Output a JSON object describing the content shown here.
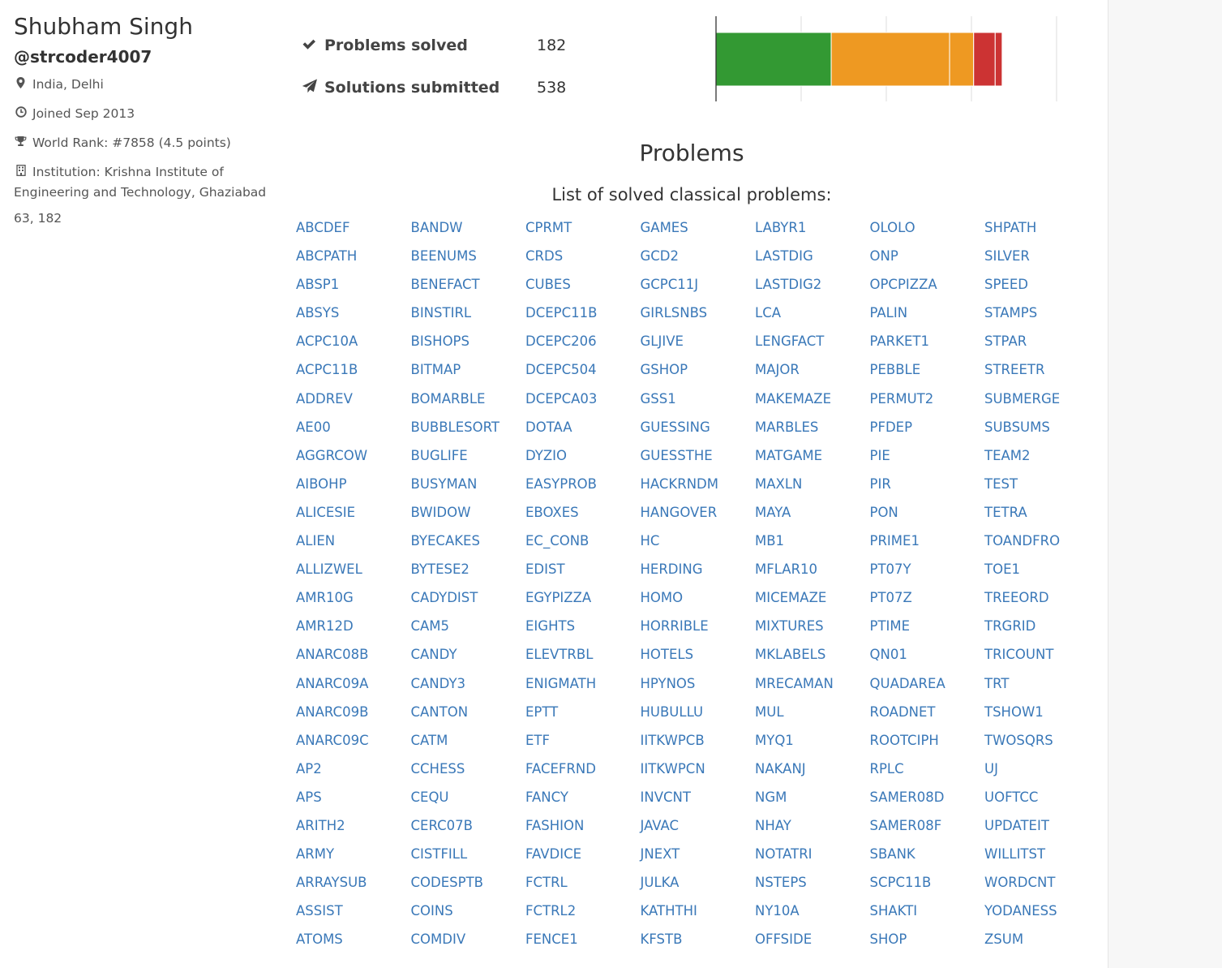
{
  "profile": {
    "name": "Shubham Singh",
    "handle": "@strcoder4007",
    "location": "India, Delhi",
    "joined": "Joined Sep 2013",
    "rank": "World Rank: #7858 (4.5 points)",
    "institution": "Institution: Krishna Institute of Engineering and Technology, Ghaziabad",
    "counts": "63, 182",
    "icons": [
      "map-marker-icon",
      "clock-icon",
      "trophy-icon",
      "building-icon"
    ]
  },
  "stats": {
    "solved_label": "Problems solved",
    "solved_value": "182",
    "submitted_label": "Solutions submitted",
    "submitted_value": "538"
  },
  "chart_data": {
    "type": "bar",
    "orientation": "horizontal-stacked",
    "total": 538,
    "series": [
      {
        "value": 182,
        "color": "#339933"
      },
      {
        "value": 187,
        "color": "#ee9922"
      },
      {
        "value": 38,
        "color": "#ee9922"
      },
      {
        "value": 34,
        "color": "#cc3333"
      },
      {
        "value": 11,
        "color": "#cc3333"
      }
    ],
    "grid": true
  },
  "problems": {
    "title": "Problems",
    "subtitle": "List of solved classical problems:",
    "link_color": "#3a78b8",
    "columns": [
      [
        "ABCDEF",
        "ABCPATH",
        "ABSP1",
        "ABSYS",
        "ACPC10A",
        "ACPC11B",
        "ADDREV",
        "AE00",
        "AGGRCOW",
        "AIBOHP",
        "ALICESIE",
        "ALIEN",
        "ALLIZWEL",
        "AMR10G",
        "AMR12D",
        "ANARC08B",
        "ANARC09A",
        "ANARC09B",
        "ANARC09C",
        "AP2",
        "APS",
        "ARITH2",
        "ARMY",
        "ARRAYSUB",
        "ASSIST",
        "ATOMS"
      ],
      [
        "BANDW",
        "BEENUMS",
        "BENEFACT",
        "BINSTIRL",
        "BISHOPS",
        "BITMAP",
        "BOMARBLE",
        "BUBBLESORT",
        "BUGLIFE",
        "BUSYMAN",
        "BWIDOW",
        "BYECAKES",
        "BYTESE2",
        "CADYDIST",
        "CAM5",
        "CANDY",
        "CANDY3",
        "CANTON",
        "CATM",
        "CCHESS",
        "CEQU",
        "CERC07B",
        "CISTFILL",
        "CODESPTB",
        "COINS",
        "COMDIV"
      ],
      [
        "CPRMT",
        "CRDS",
        "CUBES",
        "DCEPC11B",
        "DCEPC206",
        "DCEPC504",
        "DCEPCA03",
        "DOTAA",
        "DYZIO",
        "EASYPROB",
        "EBOXES",
        "EC_CONB",
        "EDIST",
        "EGYPIZZA",
        "EIGHTS",
        "ELEVTRBL",
        "ENIGMATH",
        "EPTT",
        "ETF",
        "FACEFRND",
        "FANCY",
        "FASHION",
        "FAVDICE",
        "FCTRL",
        "FCTRL2",
        "FENCE1"
      ],
      [
        "GAMES",
        "GCD2",
        "GCPC11J",
        "GIRLSNBS",
        "GLJIVE",
        "GSHOP",
        "GSS1",
        "GUESSING",
        "GUESSTHE",
        "HACKRNDM",
        "HANGOVER",
        "HC",
        "HERDING",
        "HOMO",
        "HORRIBLE",
        "HOTELS",
        "HPYNOS",
        "HUBULLU",
        "IITKWPCB",
        "IITKWPCN",
        "INVCNT",
        "JAVAC",
        "JNEXT",
        "JULKA",
        "KATHTHI",
        "KFSTB"
      ],
      [
        "LABYR1",
        "LASTDIG",
        "LASTDIG2",
        "LCA",
        "LENGFACT",
        "MAJOR",
        "MAKEMAZE",
        "MARBLES",
        "MATGAME",
        "MAXLN",
        "MAYA",
        "MB1",
        "MFLAR10",
        "MICEMAZE",
        "MIXTURES",
        "MKLABELS",
        "MRECAMAN",
        "MUL",
        "MYQ1",
        "NAKANJ",
        "NGM",
        "NHAY",
        "NOTATRI",
        "NSTEPS",
        "NY10A",
        "OFFSIDE"
      ],
      [
        "OLOLO",
        "ONP",
        "OPCPIZZA",
        "PALIN",
        "PARKET1",
        "PEBBLE",
        "PERMUT2",
        "PFDEP",
        "PIE",
        "PIR",
        "PON",
        "PRIME1",
        "PT07Y",
        "PT07Z",
        "PTIME",
        "QN01",
        "QUADAREA",
        "ROADNET",
        "ROOTCIPH",
        "RPLC",
        "SAMER08D",
        "SAMER08F",
        "SBANK",
        "SCPC11B",
        "SHAKTI",
        "SHOP"
      ],
      [
        "SHPATH",
        "SILVER",
        "SPEED",
        "STAMPS",
        "STPAR",
        "STREETR",
        "SUBMERGE",
        "SUBSUMS",
        "TEAM2",
        "TEST",
        "TETRA",
        "TOANDFRO",
        "TOE1",
        "TREEORD",
        "TRGRID",
        "TRICOUNT",
        "TRT",
        "TSHOW1",
        "TWOSQRS",
        "UJ",
        "UOFTCC",
        "UPDATEIT",
        "WILLITST",
        "WORDCNT",
        "YODANESS",
        "ZSUM"
      ]
    ]
  }
}
